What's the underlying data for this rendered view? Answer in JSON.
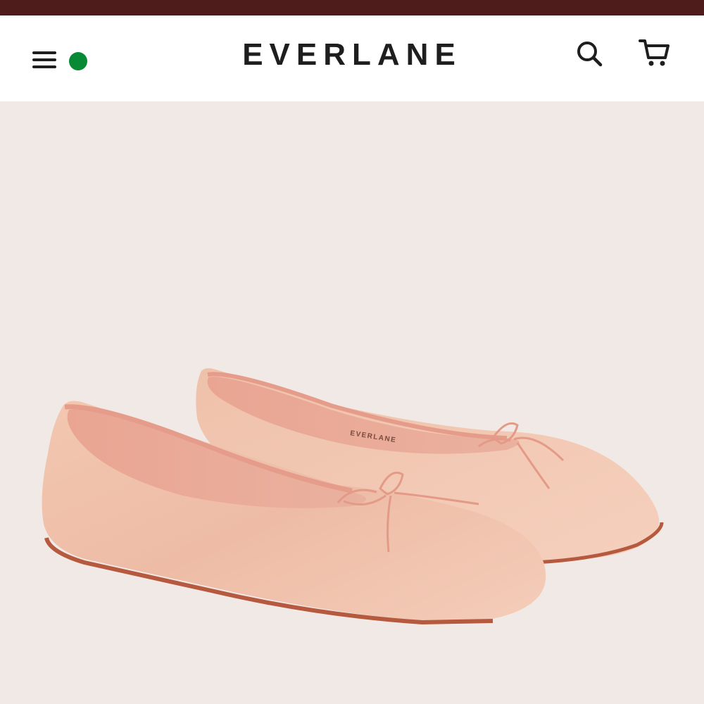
{
  "header": {
    "brand": "EVERLANE",
    "menu_icon": "hamburger-menu-icon",
    "status_indicator_color": "#078a33",
    "search_icon": "search-icon",
    "cart_icon": "cart-icon",
    "top_bar_color": "#4e1c1b"
  },
  "product_image": {
    "insole_brand": "EVERLANE",
    "subject": "pink leather ballet flats with bow"
  }
}
